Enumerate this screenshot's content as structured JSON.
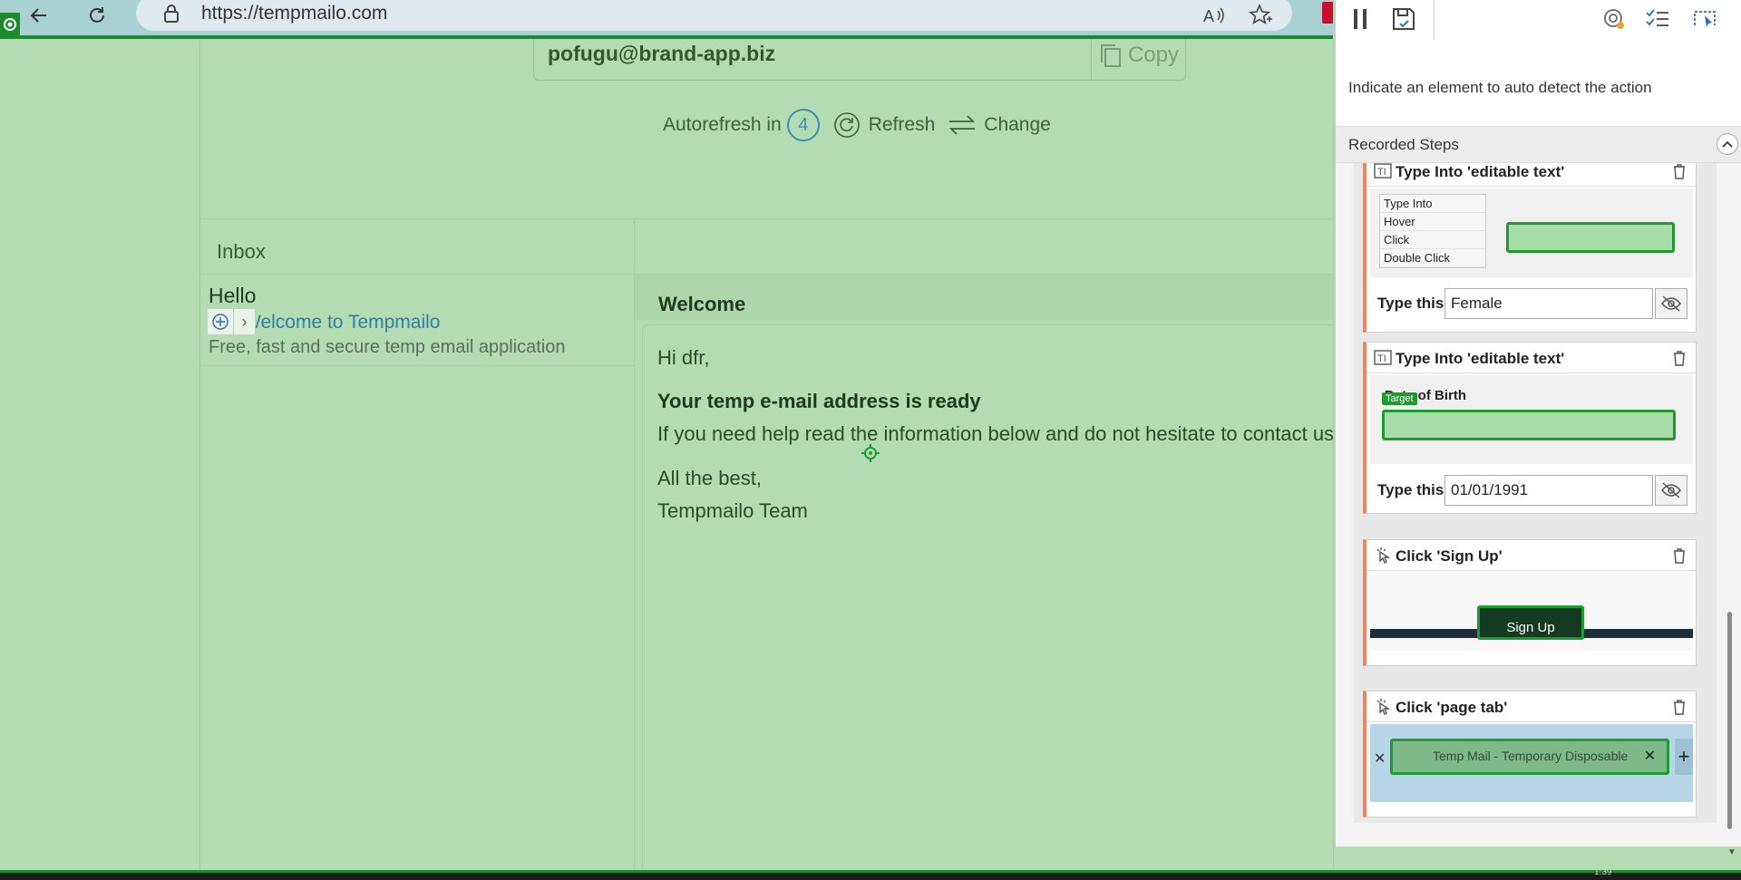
{
  "browser": {
    "url": "https://tempmailo.com",
    "back_icon": "arrow-left-icon",
    "reload_icon": "reload-icon"
  },
  "tempmail": {
    "email_address": "pofugu@brand-app.biz",
    "copy_label": "Copy",
    "autorefresh_label": "Autorefresh in",
    "autorefresh_count": "4",
    "refresh_label": "Refresh",
    "change_label": "Change"
  },
  "inbox": {
    "label": "Inbox",
    "messages": [
      {
        "from": "Hello",
        "subject": "Welcome to Tempmailo",
        "snippet": "Free, fast and secure temp email application"
      }
    ]
  },
  "message": {
    "title": "Welcome",
    "greeting": "Hi dfr,",
    "headline": "Your temp e-mail address is ready",
    "help_text": "If you need help read the information below and do not hesitate to contact us",
    "signoff": "All the best,",
    "team": "Tempmailo Team"
  },
  "recorder": {
    "hint": "Indicate an element to auto detect the action",
    "steps_title": "Recorded Steps",
    "steps": [
      {
        "title": "Type Into 'editable text'",
        "menu_items": [
          "Type Into",
          "Hover",
          "Click",
          "Double Click"
        ],
        "type_label": "Type this",
        "value": "Female"
      },
      {
        "title": "Type Into 'editable text'",
        "thumb_label": "Date of Birth",
        "target_tag": "Target",
        "type_label": "Type this",
        "value": "01/01/1991"
      },
      {
        "title": "Click 'Sign Up'",
        "thumb_button": "Sign Up"
      },
      {
        "title": "Click 'page tab'",
        "thumb_tab": "Temp Mail - Temporary Disposable"
      }
    ]
  },
  "taskbar": {
    "clock": "1:39"
  },
  "colors": {
    "highlight_overlay": "#b3dcb3",
    "recorder_green": "#1f9a31",
    "step_accent": "#f2855e",
    "link": "#2d7fa6"
  }
}
